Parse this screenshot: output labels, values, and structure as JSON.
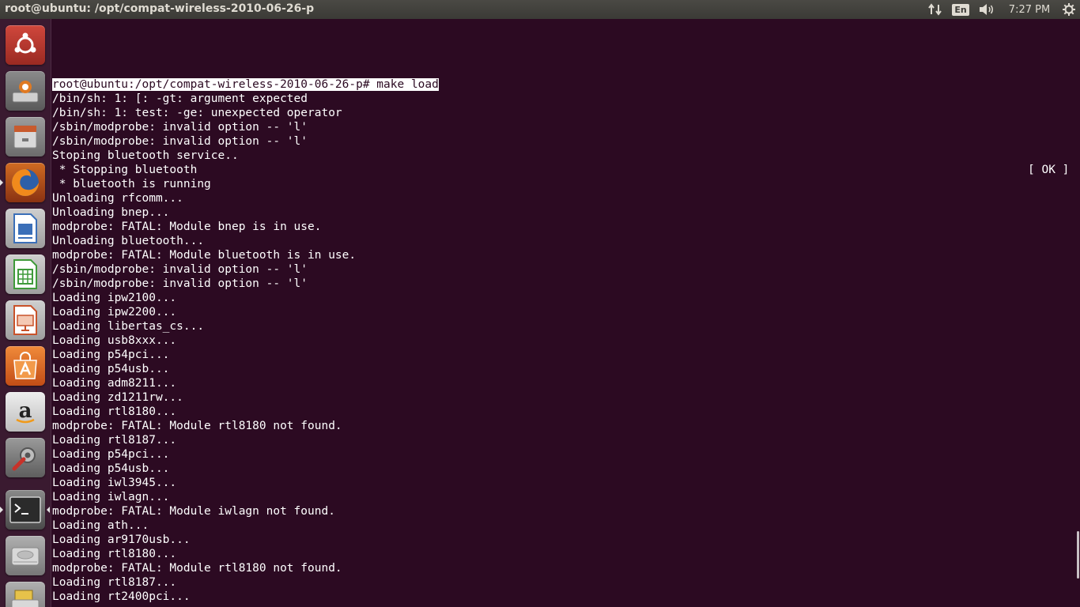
{
  "topbar": {
    "window_title": "root@ubuntu: /opt/compat-wireless-2010-06-26-p",
    "keyboard_layout": "En",
    "clock": "7:27 PM"
  },
  "launcher": {
    "items": [
      {
        "name": "dash-home-icon",
        "color": "#b8372e"
      },
      {
        "name": "install-ubuntu-icon",
        "color": "#8c8c8c"
      },
      {
        "name": "files-icon",
        "color": "#9a9a9a"
      },
      {
        "name": "firefox-icon",
        "color": "#c85a1c"
      },
      {
        "name": "libreoffice-writer-icon",
        "color": "#d0d0d0"
      },
      {
        "name": "libreoffice-calc-icon",
        "color": "#d0d0d0"
      },
      {
        "name": "libreoffice-impress-icon",
        "color": "#d0d0d0"
      },
      {
        "name": "ubuntu-software-center-icon",
        "color": "#e0642a"
      },
      {
        "name": "amazon-icon",
        "color": "#d8d8d8"
      },
      {
        "name": "system-settings-icon",
        "color": "#8a8a8a"
      },
      {
        "name": "terminal-icon",
        "color": "#6a6a6a"
      },
      {
        "name": "disk-icon",
        "color": "#a0a0a0"
      },
      {
        "name": "removable-drive-icon",
        "color": "#a0a0a0"
      }
    ]
  },
  "terminal": {
    "prompt": "root@ubuntu:/opt/compat-wireless-2010-06-26-p# make load",
    "ok_status": "[ OK ]",
    "lines": [
      "/bin/sh: 1: [: -gt: argument expected",
      "/bin/sh: 1: test: -ge: unexpected operator",
      "/sbin/modprobe: invalid option -- 'l'",
      "/sbin/modprobe: invalid option -- 'l'",
      "Stoping bluetooth service..",
      " * Stopping bluetooth",
      " * bluetooth is running",
      "Unloading rfcomm...",
      "Unloading bnep...",
      "modprobe: FATAL: Module bnep is in use.",
      "Unloading bluetooth...",
      "modprobe: FATAL: Module bluetooth is in use.",
      "/sbin/modprobe: invalid option -- 'l'",
      "/sbin/modprobe: invalid option -- 'l'",
      "Loading ipw2100...",
      "Loading ipw2200...",
      "Loading libertas_cs...",
      "Loading usb8xxx...",
      "Loading p54pci...",
      "Loading p54usb...",
      "Loading adm8211...",
      "Loading zd1211rw...",
      "Loading rtl8180...",
      "modprobe: FATAL: Module rtl8180 not found.",
      "Loading rtl8187...",
      "Loading p54pci...",
      "Loading p54usb...",
      "Loading iwl3945...",
      "Loading iwlagn...",
      "modprobe: FATAL: Module iwlagn not found.",
      "Loading ath...",
      "Loading ar9170usb...",
      "Loading rtl8180...",
      "modprobe: FATAL: Module rtl8180 not found.",
      "Loading rtl8187...",
      "Loading rt2400pci..."
    ]
  }
}
